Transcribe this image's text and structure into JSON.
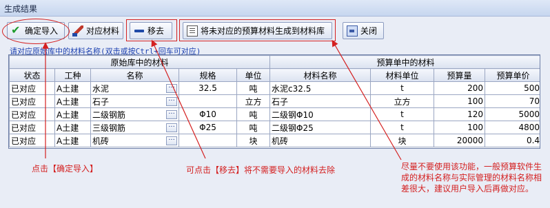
{
  "window": {
    "title": "生成结果"
  },
  "toolbar": {
    "confirm_label": "确定导入",
    "match_label": "对应材料",
    "remove_label": "移去",
    "generate_label": "将未对应的预算材料生成到材料库",
    "close_label": "关闭"
  },
  "hint": "请对应原始库中的材料名称(双击或按Ctrl+回车可对应)",
  "table": {
    "group_left": "原始库中的材料",
    "group_right": "预算单中的材料",
    "columns": [
      "状态",
      "工种",
      "名称",
      "规格",
      "单位",
      "材料名称",
      "材料单位",
      "预算量",
      "预算单价"
    ],
    "rows": [
      {
        "status": "已对应",
        "trade": "A土建",
        "name": "水泥",
        "spec": "32.5",
        "unit": "吨",
        "mname": "水泥c32.5",
        "munit": "t",
        "qty": "200",
        "price": "500"
      },
      {
        "status": "已对应",
        "trade": "A土建",
        "name": "石子",
        "spec": "",
        "unit": "立方",
        "mname": "石子",
        "munit": "立方",
        "qty": "100",
        "price": "70"
      },
      {
        "status": "已对应",
        "trade": "A土建",
        "name": "二级钢筋",
        "spec": "Φ10",
        "unit": "吨",
        "mname": "二级钢Φ10",
        "munit": "t",
        "qty": "120",
        "price": "5000"
      },
      {
        "status": "已对应",
        "trade": "A土建",
        "name": "三级钢筋",
        "spec": "Φ25",
        "unit": "吨",
        "mname": "二级钢Φ25",
        "munit": "t",
        "qty": "100",
        "price": "4800"
      },
      {
        "status": "已对应",
        "trade": "A土建",
        "name": "机砖",
        "spec": "",
        "unit": "块",
        "mname": "机砖",
        "munit": "块",
        "qty": "20000",
        "price": "0.4"
      }
    ]
  },
  "annotations": {
    "confirm": "点击【确定导入】",
    "remove": "可点击【移去】将不需要导入的材料去除",
    "generate": "尽量不要使用该功能，一般预算软件生成的材料名称与实际管理的材料名称相差很大，建议用户导入后再做对应。"
  },
  "colors": {
    "annotation": "#d42020",
    "accent": "#1a3fb0"
  },
  "icons": {
    "confirm": "check-icon",
    "match": "pen-icon",
    "remove": "minus-icon",
    "generate": "document-icon",
    "close": "exit-door-icon",
    "cell_button": "ellipsis-icon"
  }
}
